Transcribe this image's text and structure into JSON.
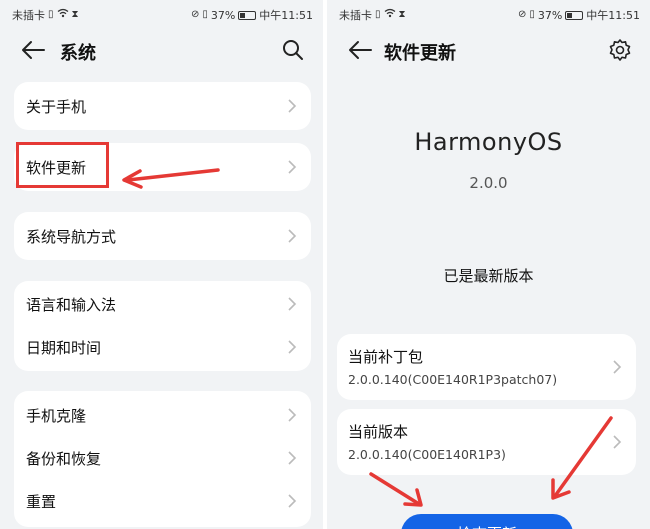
{
  "status_bar": {
    "carrier": "未插卡",
    "battery_percent": "37%",
    "time": "中午11:51"
  },
  "left_screen": {
    "title": "系统",
    "groups": [
      [
        "关于手机"
      ],
      [
        "软件更新"
      ],
      [
        "系统导航方式"
      ],
      [
        "语言和输入法",
        "日期和时间"
      ],
      [
        "手机克隆",
        "备份和恢复",
        "重置"
      ]
    ],
    "highlight_color": "#e53935"
  },
  "right_screen": {
    "title": "软件更新",
    "logo_text": "HarmonyOS",
    "os_version": "2.0.0",
    "status_text": "已是最新版本",
    "patch": {
      "label": "当前补丁包",
      "value": "2.0.0.140(C00E140R1P3patch07)"
    },
    "current_version": {
      "label": "当前版本",
      "value": "2.0.0.140(C00E140R1P3)"
    },
    "check_button": "检查更新",
    "accent_color": "#1464e6"
  }
}
